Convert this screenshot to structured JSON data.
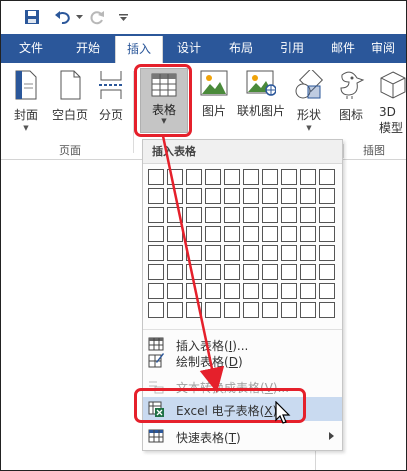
{
  "qat": {
    "save_icon": "save-icon",
    "undo_icon": "undo-icon",
    "redo_icon": "redo-icon",
    "customize_icon": "customize-qat-icon"
  },
  "tabs": [
    {
      "label": "文件"
    },
    {
      "label": "开始"
    },
    {
      "label": "插入"
    },
    {
      "label": "设计"
    },
    {
      "label": "布局"
    },
    {
      "label": "引用"
    },
    {
      "label": "邮件"
    },
    {
      "label": "审阅"
    }
  ],
  "ribbon": {
    "cover": "封面",
    "blank_page": "空白页",
    "page_break": "分页",
    "table": "表格",
    "picture": "图片",
    "online_picture": "联机图片",
    "shapes": "形状",
    "icons": "图标",
    "model3d_line1": "3D",
    "model3d_line2": "模型",
    "group_pages": "页面",
    "group_illustrations": "插图"
  },
  "dropdown": {
    "header": "插入表格",
    "insert_table_pre": "插入表格(",
    "insert_table_key": "I",
    "insert_table_post": ")...",
    "draw_table_pre": "绘制表格(",
    "draw_table_key": "D",
    "draw_table_post": ")",
    "text_to_table_pre": "文本转换成表格(",
    "text_to_table_key": "V",
    "text_to_table_post": ")...",
    "excel_pre": "Excel 电子表格(",
    "excel_key": "X",
    "excel_post": ")",
    "quick_pre": "快速表格(",
    "quick_key": "T",
    "quick_post": ")"
  },
  "colors": {
    "accent": "#2b579a",
    "highlight": "#e5202b",
    "hover": "#c9daf0"
  }
}
